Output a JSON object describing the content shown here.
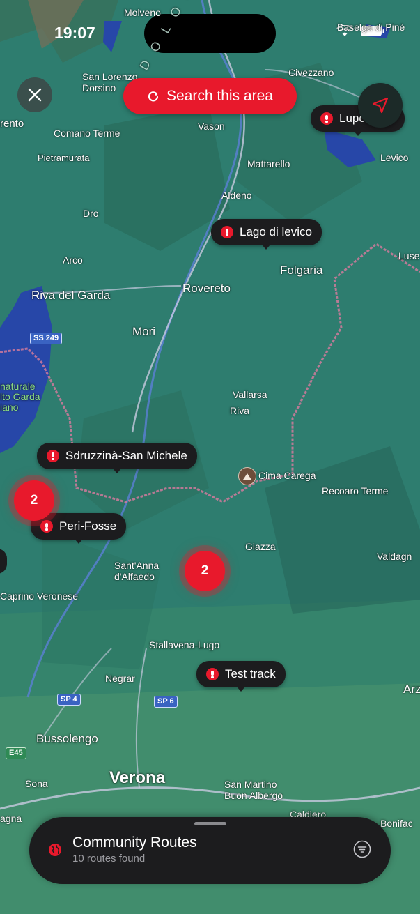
{
  "status": {
    "time": "19:07"
  },
  "colors": {
    "accent": "#e8192c",
    "land": "#2f7a6d",
    "water": "#2747a8",
    "pill": "#1c1c1e"
  },
  "controls": {
    "close_icon": "close-icon",
    "search_label": "Search this area",
    "locate_icon": "navigation-arrow-icon"
  },
  "places": {
    "molveno": "Molveno",
    "baselga": "Baselga di Pinè",
    "san_lorenzo": "San Lorenzo\nDorsino",
    "civezzano": "Civezzano",
    "rento": "rento",
    "comano": "Comano Terme",
    "vason": "Vason",
    "pietramurata": "Pietramurata",
    "mattarello": "Mattarello",
    "levico": "Levico",
    "aldeno": "Aldeno",
    "dro": "Dro",
    "arco": "Arco",
    "folgaria": "Folgaria",
    "luse": "Luse",
    "riva": "Riva del Garda",
    "rovereto": "Rovereto",
    "mori": "Mori",
    "parco": "naturale\nlto Garda\niano",
    "vallarsa": "Vallarsa",
    "riva2": "Riva",
    "cima": "Cima Carega",
    "recoaro": "Recoaro Terme",
    "giazza": "Giazza",
    "valdagno": "Valdagn",
    "santanna": "Sant'Anna\nd'Alfaedo",
    "caprino": "Caprino Veronese",
    "stallavena": "Stallavena-Lugo",
    "negrar": "Negrar",
    "arz": "Arz",
    "bussolengo": "Bussolengo",
    "sona": "Sona",
    "verona": "Verona",
    "sanmartino": "San Martino\nBuon Albergo",
    "agna": "agna",
    "caldiero": "Caldiero",
    "bonifac": "Bonifac",
    "dolomiti": "D O L O M"
  },
  "roads": {
    "ss249": "SS 249",
    "sp4": "SP 4",
    "sp6": "SP 6",
    "e45": "E45"
  },
  "routes": [
    {
      "name": "Lupo Lago"
    },
    {
      "name": "Lago di levico"
    },
    {
      "name": "Sdruzzinà-San Michele"
    },
    {
      "name": "Peri-Fosse"
    },
    {
      "name": "Test track"
    }
  ],
  "clusters": [
    {
      "count": "2"
    },
    {
      "count": "2"
    }
  ],
  "sheet": {
    "title": "Community Routes",
    "subtitle": "10 routes found",
    "filter_icon": "filter-icon",
    "globe_icon": "globe-icon"
  }
}
